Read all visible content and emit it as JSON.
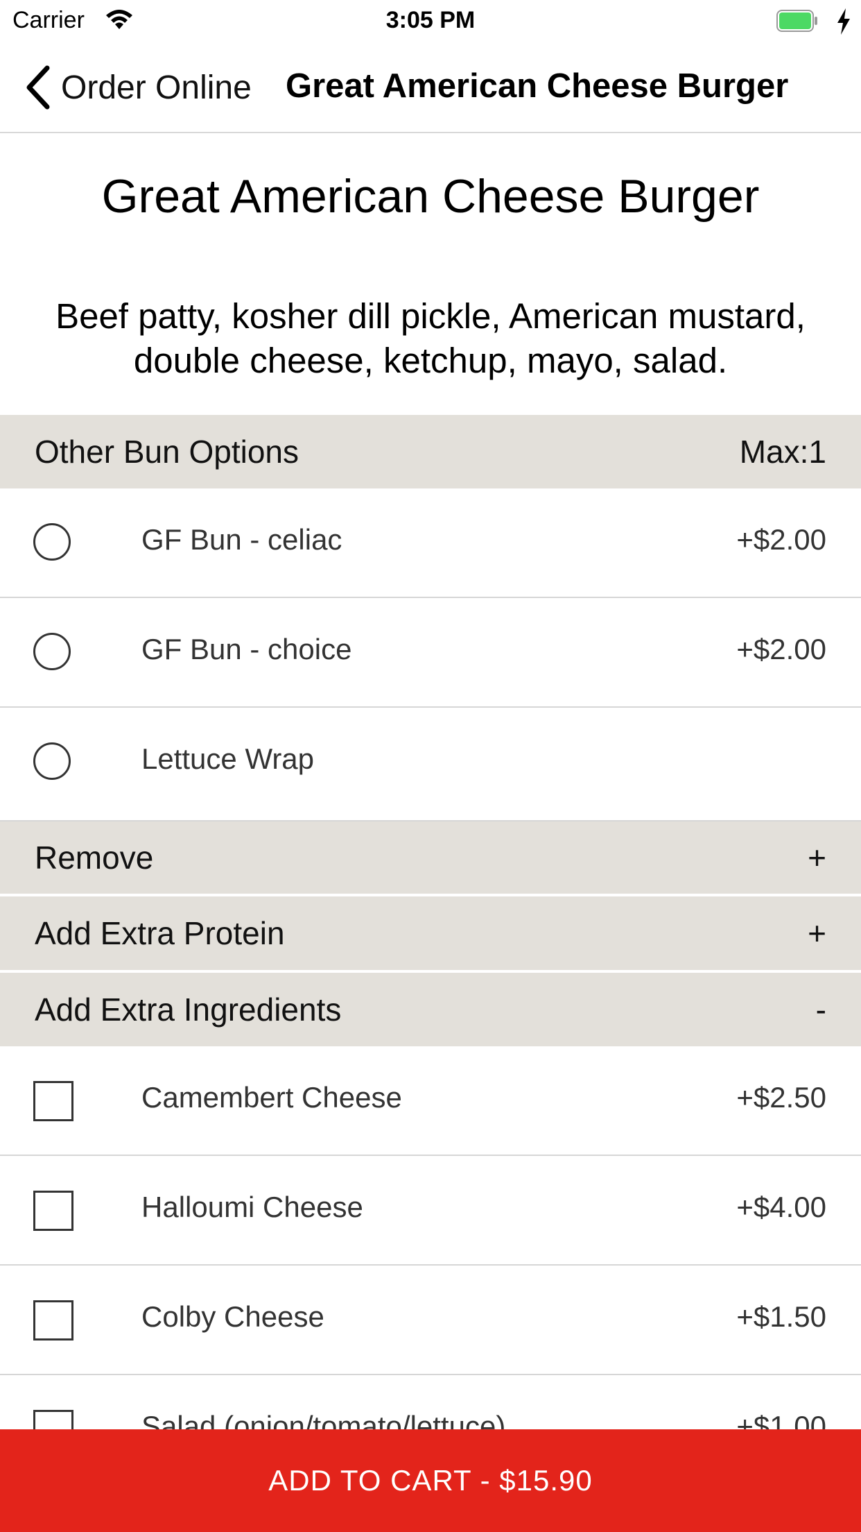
{
  "status_bar": {
    "carrier": "Carrier",
    "time": "3:05 PM"
  },
  "nav": {
    "back_label": "Order Online",
    "title": "Great American Cheese Burger"
  },
  "item": {
    "title": "Great American Cheese Burger",
    "description": "Beef patty, kosher dill pickle, American mustard, double cheese, ketchup, mayo, salad."
  },
  "sections": {
    "bun": {
      "label": "Other Bun Options",
      "max": "Max:1",
      "options": [
        {
          "label": "GF Bun - celiac",
          "price": "+$2.00"
        },
        {
          "label": "GF Bun - choice",
          "price": "+$2.00"
        },
        {
          "label": "Lettuce Wrap",
          "price": ""
        }
      ]
    },
    "remove": {
      "label": "Remove",
      "toggle": "+"
    },
    "protein": {
      "label": "Add Extra Protein",
      "toggle": "+"
    },
    "ingredients": {
      "label": "Add Extra Ingredients",
      "toggle": "-",
      "options": [
        {
          "label": "Camembert Cheese",
          "price": "+$2.50"
        },
        {
          "label": "Halloumi Cheese",
          "price": "+$4.00"
        },
        {
          "label": "Colby Cheese",
          "price": "+$1.50"
        },
        {
          "label": "Salad (onion/tomato/lettuce)",
          "price": "+$1.00"
        }
      ]
    }
  },
  "cart": {
    "label": "ADD TO CART - $15.90"
  },
  "colors": {
    "accent": "#e3241b",
    "section_bg": "#e3e0da"
  }
}
